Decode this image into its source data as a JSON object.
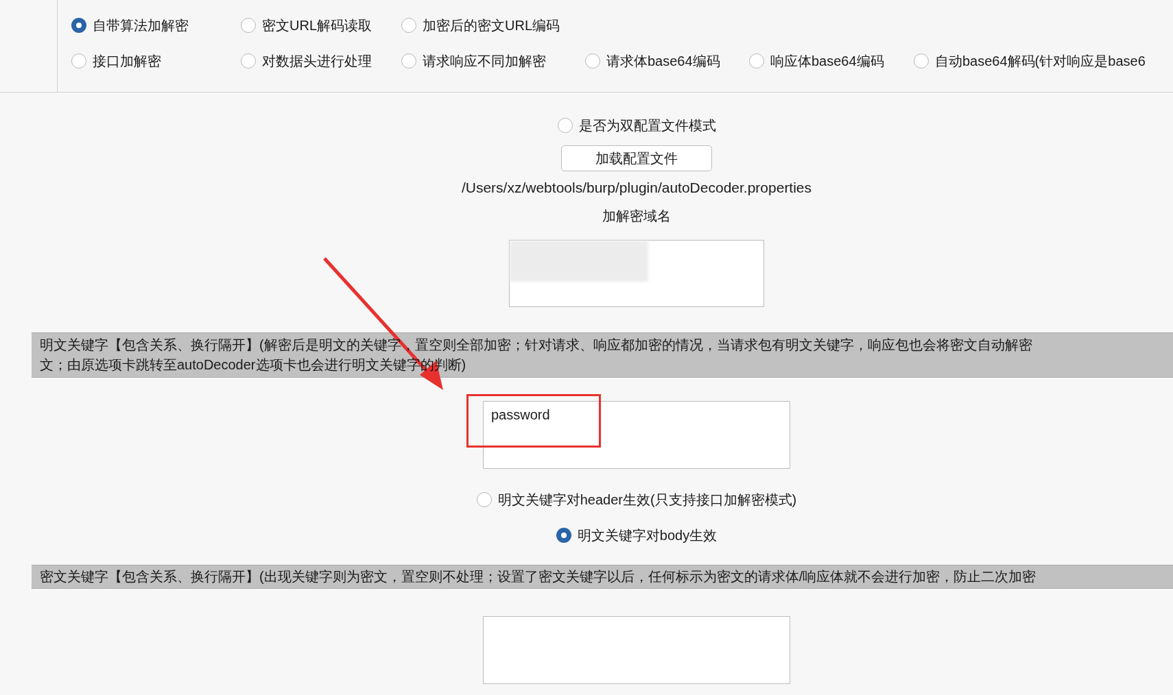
{
  "mode_options": [
    [
      {
        "label": "自带算法加解密",
        "selected": true
      },
      {
        "label": "密文URL解码读取",
        "selected": false
      },
      {
        "label": "加密后的密文URL编码",
        "selected": false
      }
    ],
    [
      {
        "label": "接口加解密",
        "selected": false
      },
      {
        "label": "对数据头进行处理",
        "selected": false
      },
      {
        "label": "请求响应不同加解密",
        "selected": false
      },
      {
        "label": "请求体base64编码",
        "selected": false
      },
      {
        "label": "响应体base64编码",
        "selected": false
      },
      {
        "label": "自动base64解码(针对响应是base6",
        "selected": false
      }
    ]
  ],
  "dual_config": {
    "label": "是否为双配置文件模式",
    "selected": false
  },
  "load_button": "加载配置文件",
  "config_path": "/Users/xz/webtools/burp/plugin/autoDecoder.properties",
  "domain_label": "加解密域名",
  "plaintext_hint": {
    "lines": [
      "明文关键字【包含关系、换行隔开】(解密后是明文的关键字，置空则全部加密；针对请求、响应都加密的情况，当请求包有明文关键字，响应包也会将密文自动解密",
      "文；由原选项卡跳转至autoDecoder选项卡也会进行明文关键字的判断)"
    ]
  },
  "plaintext_keywords": {
    "value": "password"
  },
  "keyword_scope": [
    {
      "label": "明文关键字对header生效(只支持接口加解密模式)",
      "selected": false
    },
    {
      "label": "明文关键字对body生效",
      "selected": true
    }
  ],
  "ciphertext_hint": {
    "lines": [
      "密文关键字【包含关系、换行隔开】(出现关键字则为密文，置空则不处理；设置了密文关键字以后，任何标示为密文的请求体/响应体就不会进行加密，防止二次加密"
    ]
  }
}
